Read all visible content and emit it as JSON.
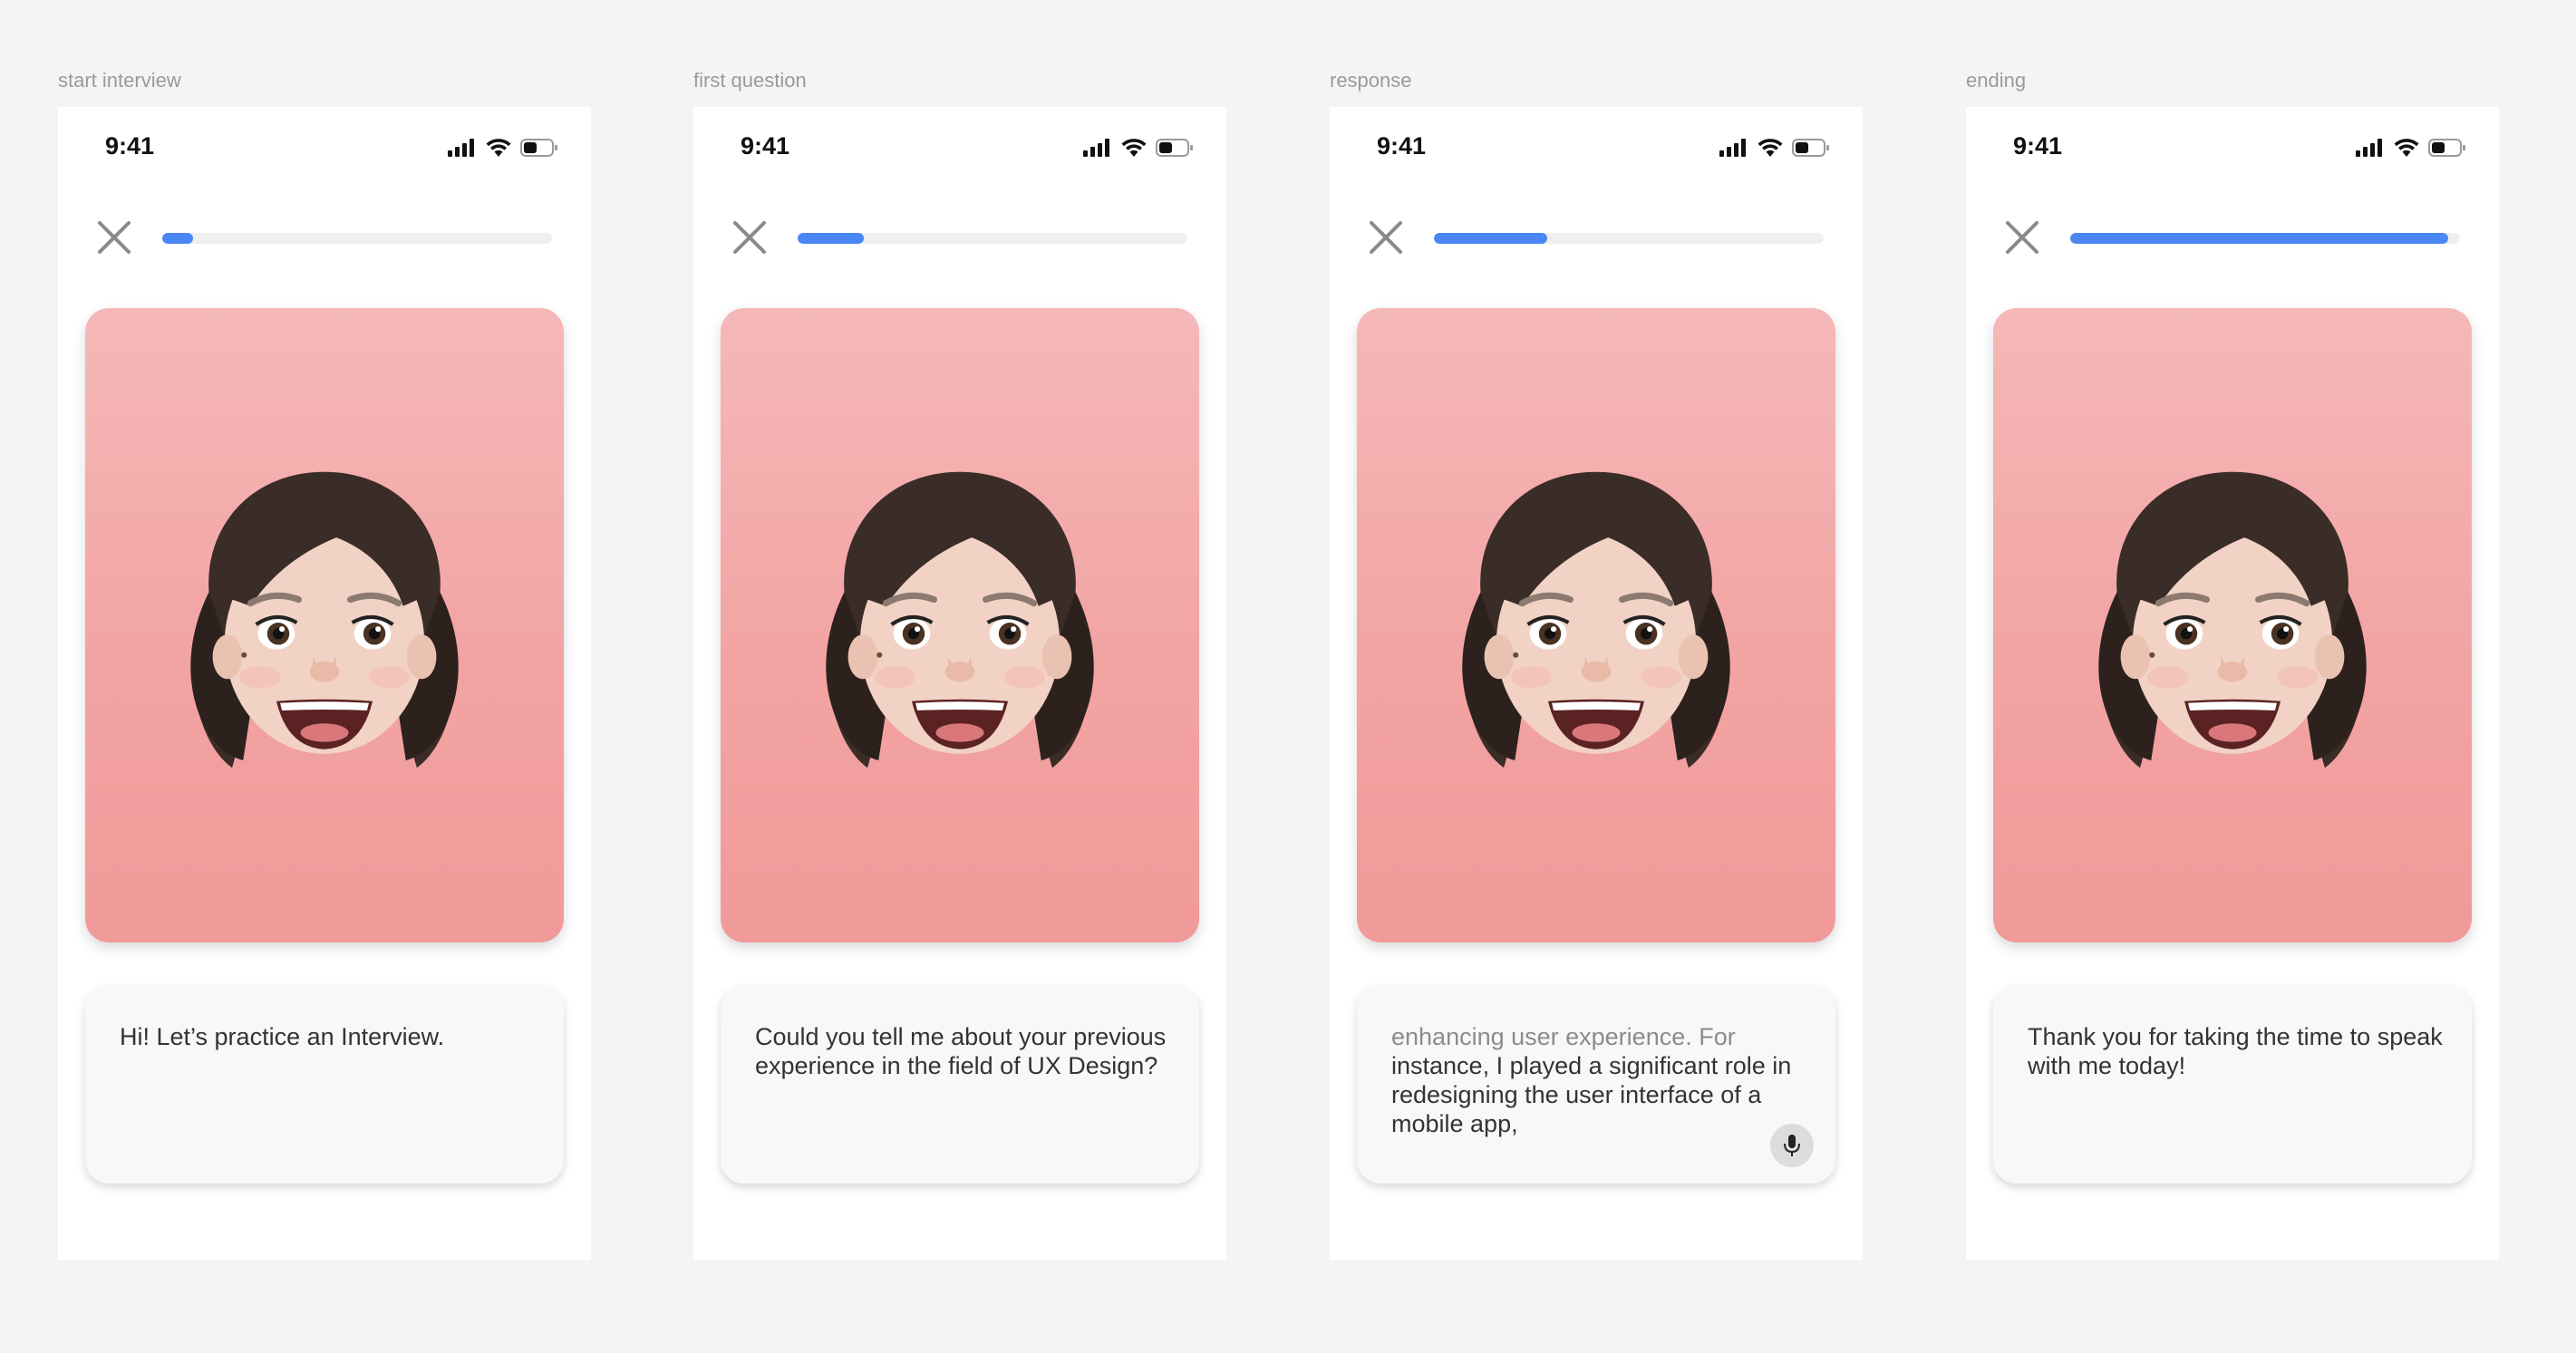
{
  "status_bar": {
    "time": "9:41"
  },
  "colors": {
    "progress": "#4a87f5",
    "track": "#efefef",
    "card_top": "#f5b8b8",
    "card_bottom": "#f09a99"
  },
  "icons": {
    "close": "close-icon",
    "signal": "cellular-signal-icon",
    "wifi": "wifi-icon",
    "battery": "battery-icon",
    "mic": "microphone-icon",
    "avatar": "memoji-avatar"
  },
  "frames": [
    {
      "label": "start interview",
      "progress": 0.08,
      "message": "Hi! Let’s practice an Interview."
    },
    {
      "label": "first question",
      "progress": 0.17,
      "message": "Could you tell me about your previous experience in the field of UX Design?"
    },
    {
      "label": "response",
      "progress": 0.29,
      "message_faded": "enhancing user experience. For",
      "message": "instance, I played a significant role in redesigning the user interface of a mobile app,"
    },
    {
      "label": "ending",
      "progress": 0.97,
      "message": "Thank you for taking the time to speak with me today!"
    }
  ]
}
